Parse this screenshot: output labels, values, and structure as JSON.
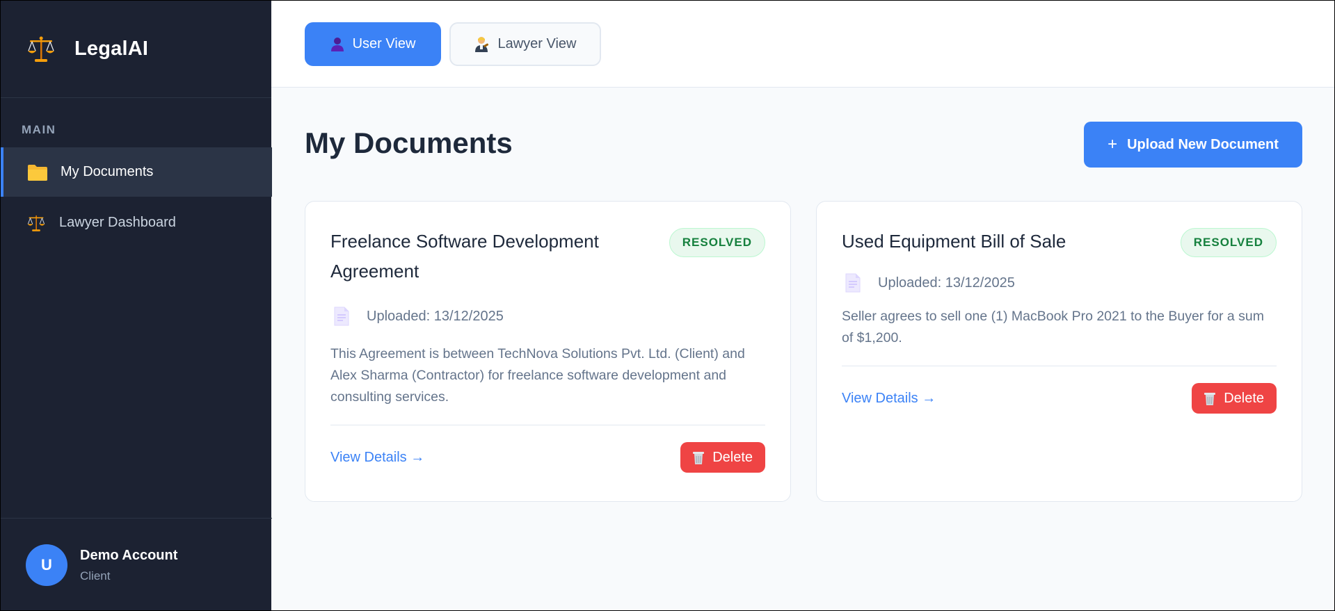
{
  "brand": {
    "name": "LegalAI",
    "icon": "scales-icon",
    "icon_color": "#f59e0b"
  },
  "sidebar": {
    "section_label": "MAIN",
    "items": [
      {
        "label": "My Documents",
        "icon": "folder-icon",
        "active": true
      },
      {
        "label": "Lawyer Dashboard",
        "icon": "scales-icon",
        "active": false
      }
    ]
  },
  "user": {
    "initial": "U",
    "name": "Demo Account",
    "role": "Client"
  },
  "view_toggle": {
    "user_label": "User View",
    "lawyer_label": "Lawyer View",
    "active": "user"
  },
  "page": {
    "title": "My Documents",
    "upload_plus": "+",
    "upload_label": "Upload New Document"
  },
  "documents": [
    {
      "title": "Freelance Software Development Agreement",
      "status": "RESOLVED",
      "uploaded": "Uploaded: 13/12/2025",
      "description": "This Agreement is between TechNova Solutions Pvt. Ltd. (Client) and Alex Sharma (Contractor) for freelance software development and consulting services.",
      "view_label": "View Details →",
      "delete_label": "Delete"
    },
    {
      "title": "Used Equipment Bill of Sale",
      "status": "RESOLVED",
      "uploaded": "Uploaded: 13/12/2025",
      "description": "Seller agrees to sell one (1) MacBook Pro 2021 to the Buyer for a sum of $1,200.",
      "view_label": "View Details →",
      "delete_label": "Delete"
    }
  ],
  "colors": {
    "sidebar_bg": "#1c2232",
    "accent": "#3b82f6",
    "danger": "#ef4444",
    "success_text": "#15803d",
    "success_bg": "#e9f8ee"
  }
}
